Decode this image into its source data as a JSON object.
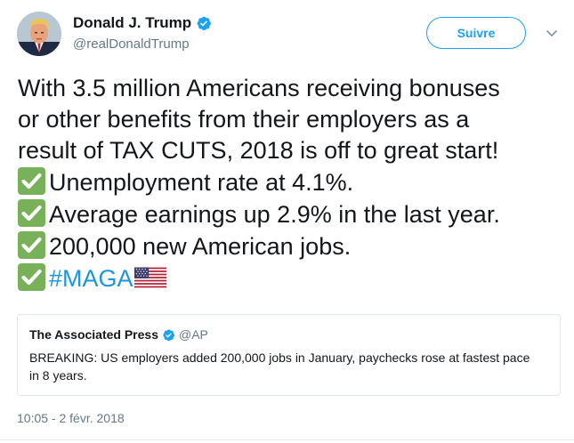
{
  "author": {
    "display_name": "Donald J. Trump",
    "handle": "@realDonaldTrump",
    "verified_icon": "verified-badge-icon",
    "avatar_icon": "profile-avatar"
  },
  "actions": {
    "follow_label": "Suivre",
    "more_icon": "chevron-down-icon"
  },
  "tweet": {
    "line1": "With 3.5 million Americans receiving bonuses",
    "line2": "or other benefits from their employers as a",
    "line3": "result of TAX CUTS, 2018 is off to great start!",
    "bullet1": "Unemployment rate at 4.1%.",
    "bullet2": "Average earnings up 2.9% in the last year.",
    "bullet3": "200,000 new American jobs.",
    "hashtag": "#MAGA",
    "bullet_icon": "check-mark-emoji",
    "flag_icon": "us-flag-emoji"
  },
  "quoted_tweet": {
    "name": "The Associated Press",
    "handle": "@AP",
    "text": "BREAKING: US employers added 200,000 jobs in January, paychecks rose at fastest pace in 8 years."
  },
  "timestamp": "10:05 - 2 févr. 2018",
  "colors": {
    "accent": "#1da1f2",
    "hashtag": "#1b95e0",
    "check_green": "#78b159",
    "secondary_text": "#657786"
  }
}
